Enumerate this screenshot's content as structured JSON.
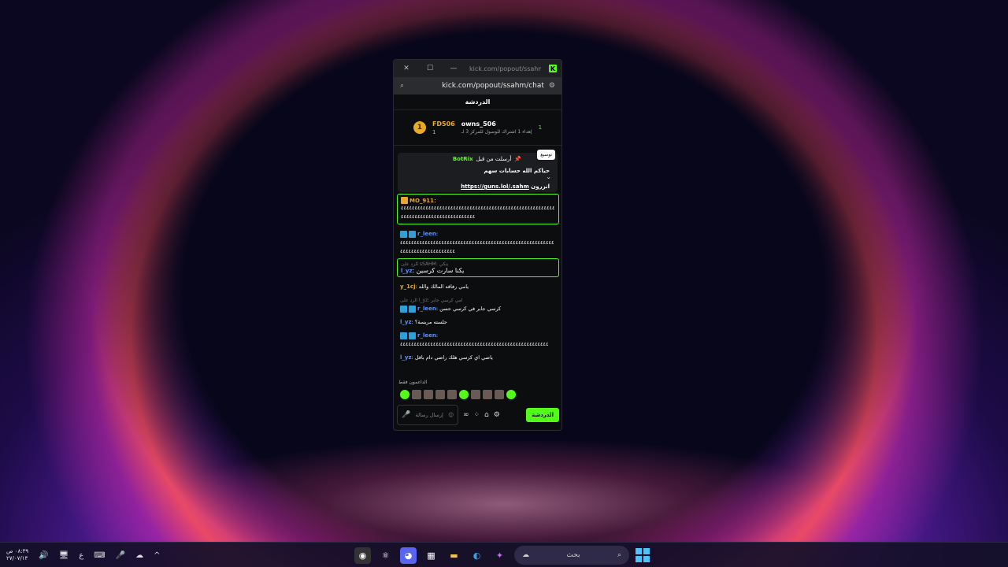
{
  "window": {
    "title": "kick.com/popout/ssahm/ch...",
    "url": "kick.com/popout/ssahm/chat",
    "chat_header": "الدردشة"
  },
  "leaderboard": {
    "rank_top": "1",
    "user_top": "FD506",
    "user_top_count": "1",
    "user_second": "owns_506",
    "user_second_count": "1",
    "sub_text": "إهداء 1 اشتراك للوصول للمركز 3 لـ"
  },
  "pinned": {
    "sent_by": "أرسلت من قبل",
    "bot": "BotRix",
    "line1": "حياكم الله حسابات سهم",
    "line2_prefix": "انزرون",
    "link": "https://guns.lol/.sahm",
    "tooltip": "توسيع"
  },
  "messages": [
    {
      "user": "MO_911",
      "text": "٤٤٤٤٤٤٤٤٤٤٤٤٤٤٤٤٤٤٤٤٤٤٤٤٤٤٤٤٤٤٤٤٤٤٤٤٤٤٤٤٤٤٤٤٤٤٤٤٤٤٤٤٤٤٤٤٤٤٤٤٤٤٤٤٤٤٤٤٤٤٤٤٤٤٤٤٤٤٤٤٤٤٤",
      "highlight": true
    },
    {
      "user": "r_leen",
      "text": "٤٤٤٤٤٤٤٤٤٤٤٤٤٤٤٤٤٤٤٤٤٤٤٤٤٤٤٤٤٤٤٤٤٤٤٤٤٤٤٤٤٤٤٤٤٤٤٤٤٤٤٤٤٤٤٤٤٤٤٤٤٤٤٤٤٤٤٤٤٤٤٤٤٤٤٤",
      "highlight": false
    },
    {
      "reply": "الرد على sSAHM: بنكي",
      "user": "l_yz",
      "text": "يكنا سارت كرسين",
      "highlight": true
    },
    {
      "user": "y_1cj",
      "text": "يامي رفاقه المالك والله",
      "highlight": false
    },
    {
      "reply": "الرد على l_yz: امي كرسي جابر",
      "user": "r_leen",
      "text": "كرسي جابر في كرسي حسن",
      "highlight": false
    },
    {
      "user": "l_yz",
      "text": "جلسته مريسة؟",
      "highlight": false
    },
    {
      "user": "r_leen",
      "text": "٤٤٤٤٤٤٤٤٤٤٤٤٤٤٤٤٤٤٤٤٤٤٤٤٤٤٤٤٤٤٤٤٤٤٤٤٤٤٤٤٤٤٤٤٤٤٤٤٤٤٤٤٤٤",
      "highlight": false
    },
    {
      "user": "l_yz",
      "text": "ياصي اي كرسي هلك راضي دام باقل",
      "highlight": false
    }
  ],
  "supporters_label": "الداعمون فقط",
  "input": {
    "placeholder": "إرسال رسالة",
    "chat_button": "الدردشة"
  },
  "taskbar": {
    "time": "٠٨:٣٩ ص",
    "date": "٢٧/٠٧/١٣",
    "search_placeholder": "بحث",
    "tray_lang": "ع"
  },
  "colors": {
    "kick_green": "#53fc18",
    "gold": "#e9a927"
  }
}
